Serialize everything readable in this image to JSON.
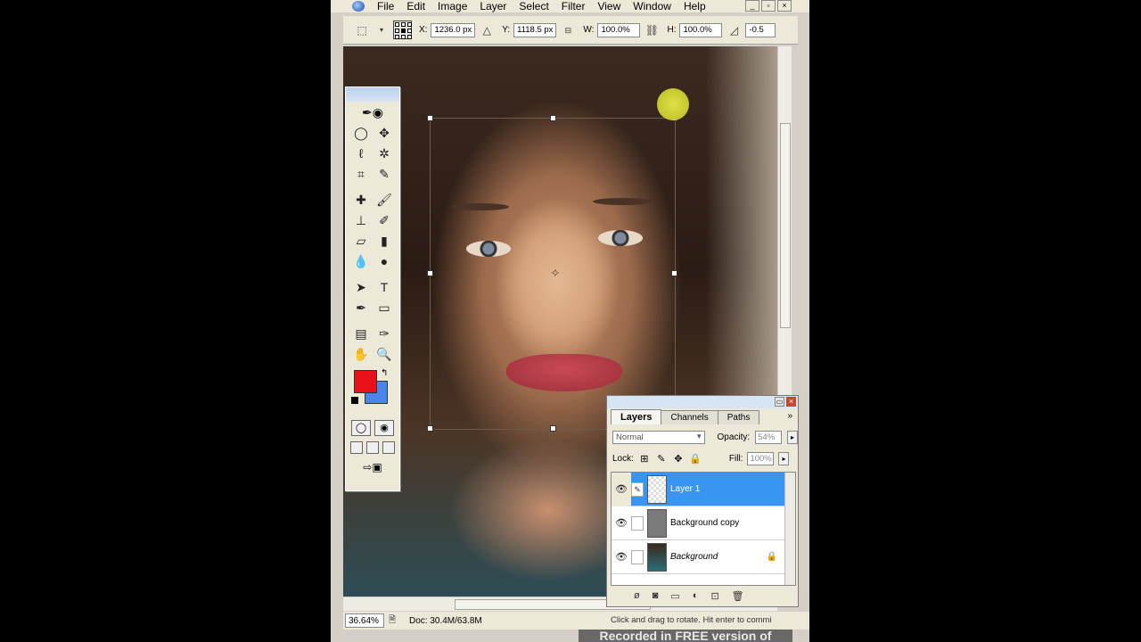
{
  "menu": {
    "items": [
      "File",
      "Edit",
      "Image",
      "Layer",
      "Select",
      "Filter",
      "View",
      "Window",
      "Help"
    ],
    "window_buttons": [
      "_",
      "▫",
      "×"
    ]
  },
  "options": {
    "x_label": "X:",
    "x_value": "1236.0 px",
    "y_label": "Y:",
    "y_value": "1118.5 px",
    "w_label": "W:",
    "w_value": "100.0%",
    "h_label": "H:",
    "h_value": "100.0%",
    "angle_value": "-0.5"
  },
  "toolbox": {
    "foreground_color": "#e8101a",
    "background_color": "#4a86ea"
  },
  "layers_panel": {
    "tabs": [
      "Layers",
      "Channels",
      "Paths"
    ],
    "blend_mode": "Normal",
    "opacity_label": "Opacity:",
    "opacity_value": "54%",
    "lock_label": "Lock:",
    "fill_label": "Fill:",
    "fill_value": "100%",
    "layers": [
      {
        "name": "Layer 1",
        "selected": true
      },
      {
        "name": "Background copy",
        "selected": false
      },
      {
        "name": "Background",
        "selected": false,
        "locked": true
      }
    ]
  },
  "status": {
    "zoom": "36.64%",
    "doc": "Doc: 30.4M/63.8M",
    "hint": "Click and drag to rotate. Hit enter to commi"
  },
  "watermark": "Recorded in FREE version of"
}
